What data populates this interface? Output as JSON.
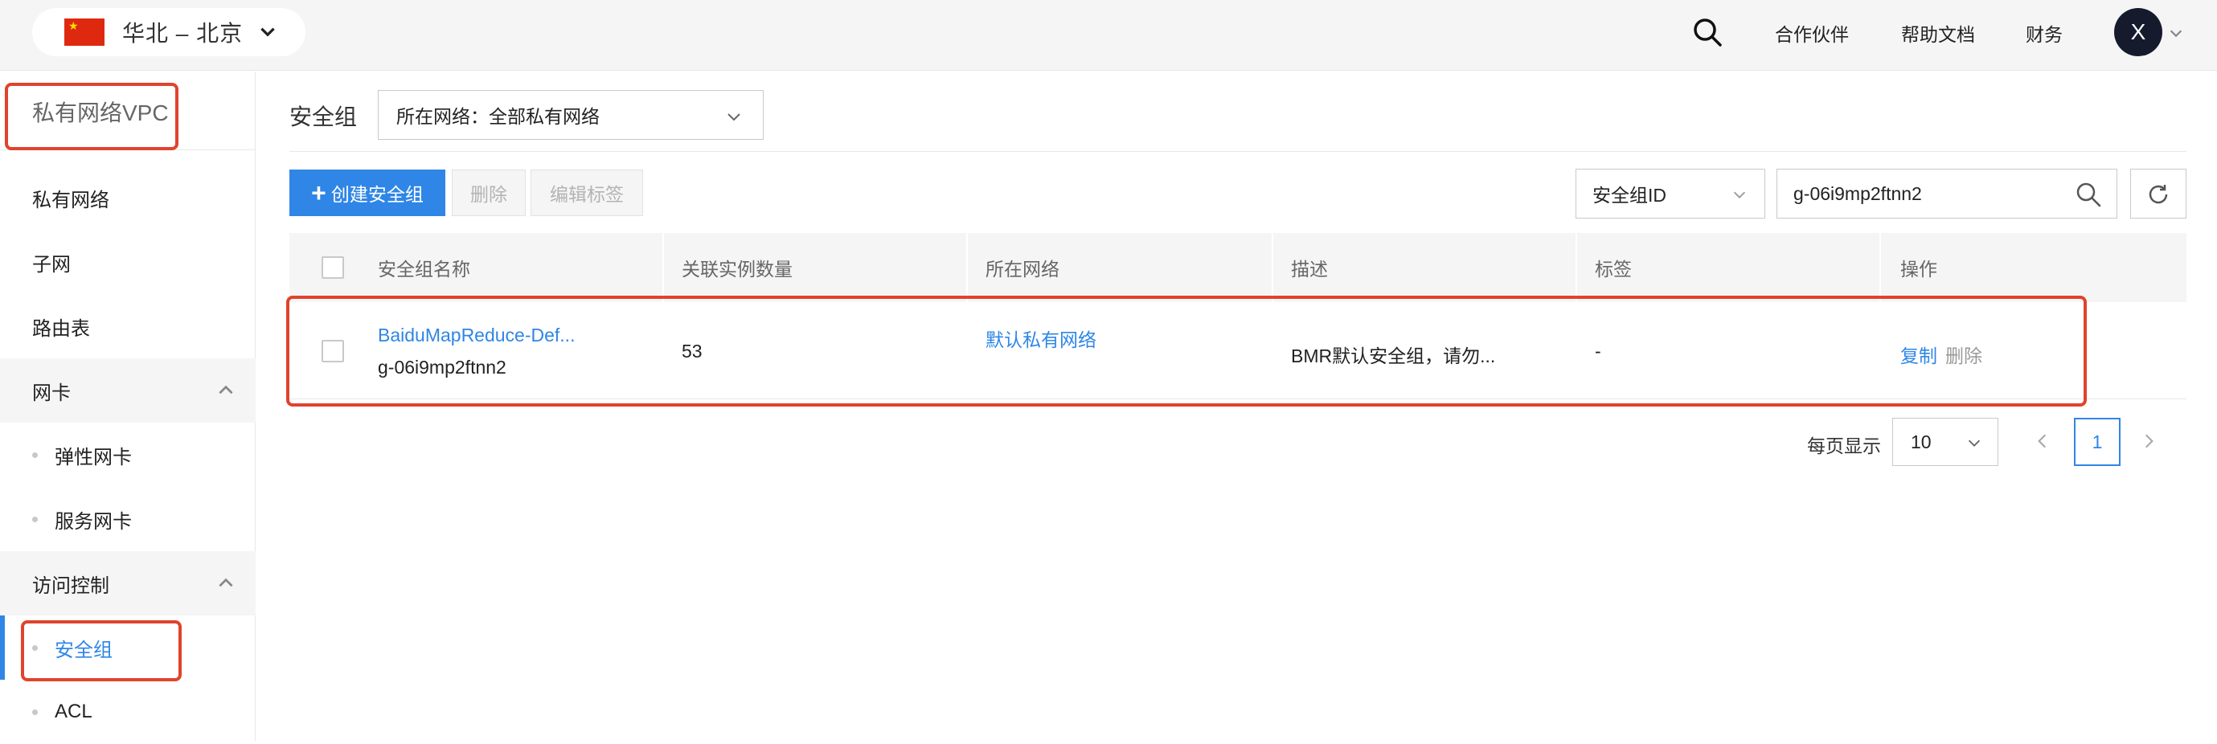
{
  "header": {
    "region_label": "华北 – 北京",
    "links": [
      "合作伙伴",
      "帮助文档",
      "财务"
    ],
    "avatar_letter": "X",
    "icons": {
      "search": "search-icon",
      "region_toggle": "chevron-down-icon",
      "account_toggle": "chevron-down-icon",
      "flag": "china-flag-icon"
    }
  },
  "sidebar": {
    "title": "私有网络VPC",
    "items": [
      {
        "label": "私有网络"
      },
      {
        "label": "子网"
      },
      {
        "label": "路由表"
      }
    ],
    "groups": [
      {
        "label": "网卡",
        "children": [
          "弹性网卡",
          "服务网卡"
        ]
      },
      {
        "label": "访问控制",
        "children": [
          "安全组",
          "ACL"
        ]
      }
    ],
    "active_item": "安全组"
  },
  "main": {
    "title": "安全组",
    "vpc_filter": "所在网络：全部私有网络",
    "toolbar": {
      "create_label": "创建安全组",
      "delete_label": "删除",
      "edit_tags_label": "编辑标签"
    },
    "search": {
      "field_label": "安全组ID",
      "value": "g-06i9mp2ftnn2"
    },
    "table": {
      "columns": [
        "安全组名称",
        "关联实例数量",
        "所在网络",
        "描述",
        "标签",
        "操作"
      ],
      "rows": [
        {
          "name": "BaiduMapReduce-Def...",
          "id": "g-06i9mp2ftnn2",
          "instances": "53",
          "network": "默认私有网络",
          "description": "BMR默认安全组，请勿...",
          "tags": "-",
          "actions": [
            "复制",
            "删除"
          ]
        }
      ]
    },
    "pagination": {
      "page_size_label": "每页显示",
      "page_size": "10",
      "current_page": "1"
    }
  },
  "colors": {
    "primary": "#2f86e6",
    "highlight": "#e0432c",
    "header_bg": "#f5f5f5",
    "avatar_bg": "#151b2c"
  }
}
